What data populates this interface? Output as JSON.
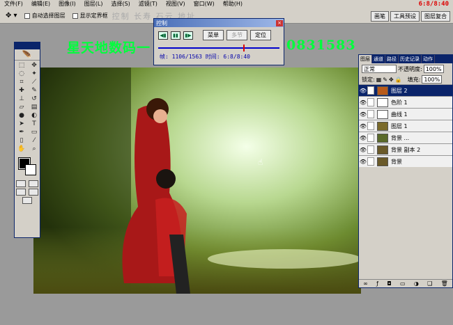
{
  "menu": [
    "文件(F)",
    "编辑(E)",
    "图像(I)",
    "图层(L)",
    "选择(S)",
    "滤镜(T)",
    "视图(V)",
    "窗口(W)",
    "帮助(H)"
  ],
  "clock": "6:8/8:40",
  "options": {
    "tool_icon": "move-arrow-icon",
    "auto_select_label": "自动选择图层",
    "show_bounds_label": "显示定界框",
    "ghost_text": "控制 长寿 石云 地址"
  },
  "right_tabs": [
    "画笔",
    "工具预设",
    "图层复合"
  ],
  "overlay": {
    "left_text": "星天地数码一",
    "right_text": "0831583"
  },
  "control": {
    "title": "控制",
    "btn_menu": "菜单",
    "btn_chapter": "多节",
    "btn_locate": "定位",
    "status": "帧: 1106/1563 时间: 6:8/8:40",
    "progress": 0.7
  },
  "layers_panel": {
    "tabs": [
      "图层",
      "通道",
      "路径",
      "历史记录",
      "动作"
    ],
    "blend_mode": "正常",
    "opacity_label": "不透明度:",
    "opacity": "100%",
    "lock_label": "锁定:",
    "fill_label": "填充:",
    "fill": "100%",
    "layers": [
      {
        "name": "图层 2",
        "selected": true,
        "thumb": "#b85a1a"
      },
      {
        "name": "色阶 1",
        "selected": false,
        "thumb": "#fff"
      },
      {
        "name": "曲线 1",
        "selected": false,
        "thumb": "#fff"
      },
      {
        "name": "图层 1",
        "selected": false,
        "thumb": "#7a6a2a"
      },
      {
        "name": "背景 ...",
        "selected": false,
        "thumb": "#5a6a2a"
      },
      {
        "name": "背景 副本 2",
        "selected": false,
        "thumb": "#6a5a2a"
      },
      {
        "name": "背景",
        "selected": false,
        "thumb": "#6a5a2a"
      }
    ]
  }
}
